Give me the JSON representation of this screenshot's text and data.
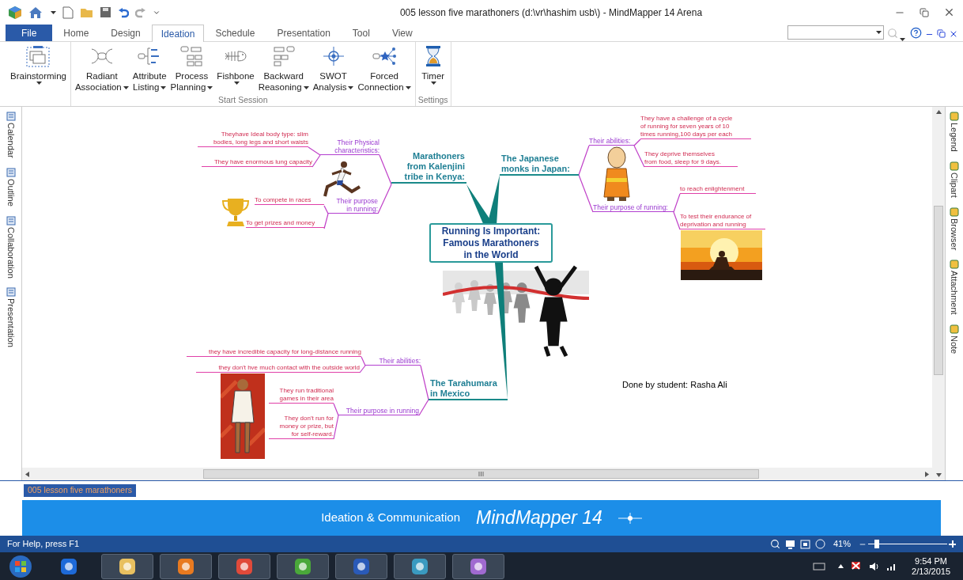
{
  "window": {
    "title": "005 lesson five marathoners (d:\\vr\\hashim usb\\) -  MindMapper 14 Arena"
  },
  "ribbon_tabs": [
    {
      "label": "File",
      "kind": "file",
      "selected": false
    },
    {
      "label": "Home",
      "kind": "tab",
      "selected": false
    },
    {
      "label": "Design",
      "kind": "tab",
      "selected": false
    },
    {
      "label": "Ideation",
      "kind": "tab",
      "selected": true
    },
    {
      "label": "Schedule",
      "kind": "tab",
      "selected": false
    },
    {
      "label": "Presentation",
      "kind": "tab",
      "selected": false
    },
    {
      "label": "Tool",
      "kind": "tab",
      "selected": false
    },
    {
      "label": "View",
      "kind": "tab",
      "selected": false
    }
  ],
  "ribbon_groups": [
    {
      "buttons": [
        {
          "lines": [
            "Brainstorming"
          ]
        }
      ]
    },
    {
      "label": "Start Session",
      "buttons": [
        {
          "lines": [
            "Radiant",
            "Association"
          ]
        },
        {
          "lines": [
            "Attribute",
            "Listing"
          ]
        },
        {
          "lines": [
            "Process",
            "Planning"
          ]
        },
        {
          "lines": [
            "Fishbone"
          ]
        },
        {
          "lines": [
            "Backward",
            "Reasoning"
          ]
        },
        {
          "lines": [
            "SWOT",
            "Analysis"
          ]
        },
        {
          "lines": [
            "Forced",
            "Connection"
          ]
        }
      ]
    },
    {
      "label": "Settings",
      "buttons": [
        {
          "lines": [
            "Timer"
          ]
        }
      ]
    }
  ],
  "left_panel": [
    {
      "label": "Calendar"
    },
    {
      "label": "Outline"
    },
    {
      "label": "Collaboration"
    },
    {
      "label": "Presentation"
    }
  ],
  "right_panel": [
    {
      "label": "Legend"
    },
    {
      "label": "Clipart"
    },
    {
      "label": "Browser"
    },
    {
      "label": "Attachment"
    },
    {
      "label": "Note"
    }
  ],
  "map": {
    "central": {
      "lines": [
        "Running Is Important:",
        "Famous Marathoners",
        "in the World"
      ]
    },
    "topics": [
      {
        "lines": [
          "Marathoners",
          "from Kalenjini",
          "tribe in Kenya:"
        ],
        "children": [
          {
            "lines": [
              "Their Physical",
              "characteristics:"
            ],
            "children": [
              {
                "lines": [
                  "Theyhave Ideal body type: slim",
                  "bodies, long legs and short waists"
                ]
              },
              {
                "lines": [
                  "They have enormous lung capacity"
                ]
              }
            ]
          },
          {
            "lines": [
              "Their purpose",
              "in running:"
            ],
            "children": [
              {
                "lines": [
                  "To compete in races"
                ]
              },
              {
                "lines": [
                  "To get prizes and money"
                ]
              }
            ]
          }
        ]
      },
      {
        "lines": [
          "The Japanese",
          "monks in Japan:"
        ],
        "children": [
          {
            "lines": [
              "Their abilities:"
            ],
            "children": [
              {
                "lines": [
                  "They have a challenge of  a cycle",
                  "of running for seven years of 10",
                  "times running,100 days per each"
                ]
              },
              {
                "lines": [
                  "They deprive themselves",
                  "from food, sleep for 9 days."
                ]
              }
            ]
          },
          {
            "lines": [
              "Their purpose of running:"
            ],
            "children": [
              {
                "lines": [
                  "to reach enlightenment"
                ]
              },
              {
                "lines": [
                  "To test their endurance of",
                  "deprivation and running"
                ]
              }
            ]
          }
        ]
      },
      {
        "lines": [
          "The Tarahumara",
          "in Mexico"
        ],
        "children": [
          {
            "lines": [
              "Their abilities:"
            ],
            "children": [
              {
                "lines": [
                  "they have incredible capacity for long-distance running"
                ]
              },
              {
                "lines": [
                  "they don't hve much contact with the outside world"
                ]
              }
            ]
          },
          {
            "lines": [
              "Their purpose in running"
            ],
            "children": [
              {
                "lines": [
                  "They run traditional",
                  "games in their area"
                ]
              },
              {
                "lines": [
                  "They don't run for",
                  "money or prize, but",
                  "for self-reward."
                ]
              }
            ]
          }
        ]
      }
    ],
    "note": "Done by student: Rasha Ali"
  },
  "document_tab": {
    "label": "005 lesson five marathoners"
  },
  "banner": {
    "tagline": "Ideation & Communication",
    "product": "MindMapper 14"
  },
  "status_bar": {
    "help": "For Help, press F1",
    "zoom": "41%",
    "zoom_slider": {
      "level": 0.08
    }
  },
  "taskbar": {
    "time": "9:54 PM",
    "date": "2/13/2015"
  }
}
